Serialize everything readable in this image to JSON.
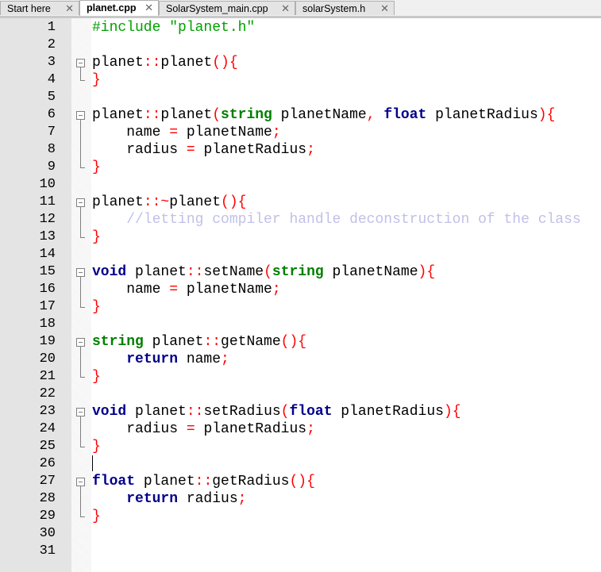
{
  "tabs": [
    {
      "label": "Start here",
      "active": false
    },
    {
      "label": "planet.cpp",
      "active": true
    },
    {
      "label": "SolarSystem_main.cpp",
      "active": false
    },
    {
      "label": "solarSystem.h",
      "active": false
    }
  ],
  "close_glyph": "✕",
  "lines": [
    [
      [
        "pp",
        "#include \"planet.h\""
      ]
    ],
    [],
    [
      [
        "pl",
        "planet"
      ],
      [
        "op",
        "::"
      ],
      [
        "pl",
        "planet"
      ],
      [
        "op",
        "(){"
      ]
    ],
    [
      [
        "op",
        "}"
      ]
    ],
    [],
    [
      [
        "pl",
        "planet"
      ],
      [
        "op",
        "::"
      ],
      [
        "pl",
        "planet"
      ],
      [
        "op",
        "("
      ],
      [
        "ty",
        "string"
      ],
      [
        "pl",
        " planetName"
      ],
      [
        "op",
        ","
      ],
      [
        "pl",
        " "
      ],
      [
        "kw",
        "float"
      ],
      [
        "pl",
        " planetRadius"
      ],
      [
        "op",
        "){"
      ]
    ],
    [
      [
        "pl",
        "    name "
      ],
      [
        "op",
        "="
      ],
      [
        "pl",
        " planetName"
      ],
      [
        "op",
        ";"
      ]
    ],
    [
      [
        "pl",
        "    radius "
      ],
      [
        "op",
        "="
      ],
      [
        "pl",
        " planetRadius"
      ],
      [
        "op",
        ";"
      ]
    ],
    [
      [
        "op",
        "}"
      ]
    ],
    [],
    [
      [
        "pl",
        "planet"
      ],
      [
        "op",
        "::~"
      ],
      [
        "pl",
        "planet"
      ],
      [
        "op",
        "(){"
      ]
    ],
    [
      [
        "pl",
        "    "
      ],
      [
        "cm",
        "//letting compiler handle deconstruction of the class"
      ]
    ],
    [
      [
        "op",
        "}"
      ]
    ],
    [],
    [
      [
        "kw",
        "void"
      ],
      [
        "pl",
        " planet"
      ],
      [
        "op",
        "::"
      ],
      [
        "pl",
        "setName"
      ],
      [
        "op",
        "("
      ],
      [
        "ty",
        "string"
      ],
      [
        "pl",
        " planetName"
      ],
      [
        "op",
        "){"
      ]
    ],
    [
      [
        "pl",
        "    name "
      ],
      [
        "op",
        "="
      ],
      [
        "pl",
        " planetName"
      ],
      [
        "op",
        ";"
      ]
    ],
    [
      [
        "op",
        "}"
      ]
    ],
    [],
    [
      [
        "ty",
        "string"
      ],
      [
        "pl",
        " planet"
      ],
      [
        "op",
        "::"
      ],
      [
        "pl",
        "getName"
      ],
      [
        "op",
        "(){"
      ]
    ],
    [
      [
        "pl",
        "    "
      ],
      [
        "kw",
        "return"
      ],
      [
        "pl",
        " name"
      ],
      [
        "op",
        ";"
      ]
    ],
    [
      [
        "op",
        "}"
      ]
    ],
    [],
    [
      [
        "kw",
        "void"
      ],
      [
        "pl",
        " planet"
      ],
      [
        "op",
        "::"
      ],
      [
        "pl",
        "setRadius"
      ],
      [
        "op",
        "("
      ],
      [
        "kw",
        "float"
      ],
      [
        "pl",
        " planetRadius"
      ],
      [
        "op",
        "){"
      ]
    ],
    [
      [
        "pl",
        "    radius "
      ],
      [
        "op",
        "="
      ],
      [
        "pl",
        " planetRadius"
      ],
      [
        "op",
        ";"
      ]
    ],
    [
      [
        "op",
        "}"
      ]
    ],
    [],
    [
      [
        "kw",
        "float"
      ],
      [
        "pl",
        " planet"
      ],
      [
        "op",
        "::"
      ],
      [
        "pl",
        "getRadius"
      ],
      [
        "op",
        "(){"
      ]
    ],
    [
      [
        "pl",
        "    "
      ],
      [
        "kw",
        "return"
      ],
      [
        "pl",
        " radius"
      ],
      [
        "op",
        ";"
      ]
    ],
    [
      [
        "op",
        "}"
      ]
    ],
    [],
    []
  ],
  "folds": [
    [
      3,
      4
    ],
    [
      6,
      9
    ],
    [
      11,
      13
    ],
    [
      15,
      17
    ],
    [
      19,
      21
    ],
    [
      23,
      25
    ],
    [
      27,
      29
    ]
  ]
}
